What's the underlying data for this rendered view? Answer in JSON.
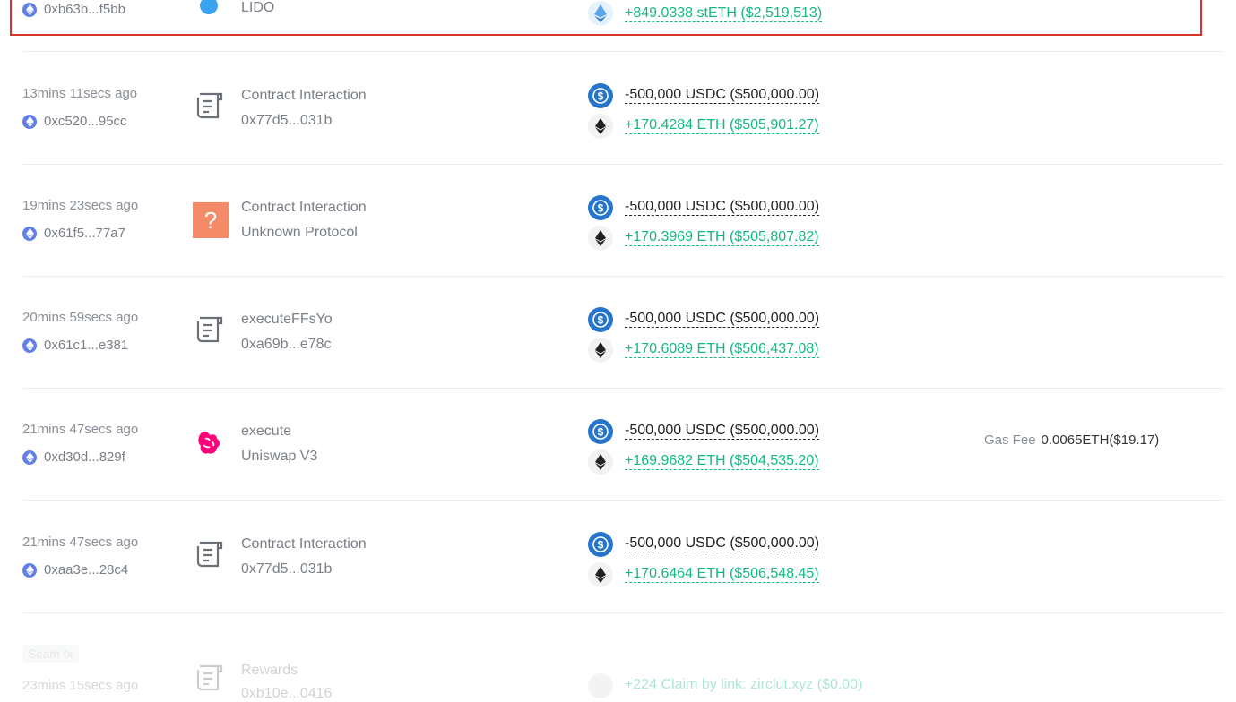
{
  "rows": [
    {
      "address": "0xb63b...f5bb",
      "protocol_name": "LIDO",
      "amount_in": "+849.0338 stETH ($2,519,513)"
    },
    {
      "time": "13mins 11secs ago",
      "address": "0xc520...95cc",
      "protocol_name": "Contract Interaction",
      "protocol_sub": "0x77d5...031b",
      "amount_out": "-500,000 USDC ($500,000.00)",
      "amount_in": "+170.4284 ETH ($505,901.27)"
    },
    {
      "time": "19mins 23secs ago",
      "address": "0x61f5...77a7",
      "protocol_name": "Contract Interaction",
      "protocol_sub": "Unknown Protocol",
      "amount_out": "-500,000 USDC ($500,000.00)",
      "amount_in": "+170.3969 ETH ($505,807.82)"
    },
    {
      "time": "20mins 59secs ago",
      "address": "0x61c1...e381",
      "protocol_name": "executeFFsYo",
      "protocol_sub": "0xa69b...e78c",
      "amount_out": "-500,000 USDC ($500,000.00)",
      "amount_in": "+170.6089 ETH ($506,437.08)"
    },
    {
      "time": "21mins 47secs ago",
      "address": "0xd30d...829f",
      "protocol_name": "execute",
      "protocol_sub": "Uniswap V3",
      "amount_out": "-500,000 USDC ($500,000.00)",
      "amount_in": "+169.9682 ETH ($504,535.20)",
      "gas_label": "Gas Fee",
      "gas_value": "0.0065ETH($19.17)"
    },
    {
      "time": "21mins 47secs ago",
      "address": "0xaa3e...28c4",
      "protocol_name": "Contract Interaction",
      "protocol_sub": "0x77d5...031b",
      "amount_out": "-500,000 USDC ($500,000.00)",
      "amount_in": "+170.6464 ETH ($506,548.45)"
    },
    {
      "badge": "Scam tx",
      "time": "23mins 15secs ago",
      "protocol_name": "Rewards",
      "protocol_sub": "0xb10e...0416",
      "amount_in": "+224 Claim by link: zirclut.xyz ($0.00)"
    }
  ],
  "colors": {
    "positive": "#12b886",
    "highlight_border": "#d6332b",
    "usdc": "#2775ca",
    "chain": "#627eea"
  },
  "icons": {
    "chain": "ethereum-chain-icon",
    "usdc": "usdc-token-icon",
    "eth": "eth-token-icon",
    "steth": "steth-token-icon",
    "contract": "contract-document-icon",
    "unknown": "unknown-protocol-icon",
    "uniswap": "uniswap-unicorn-icon",
    "lido": "lido-drop-icon"
  }
}
